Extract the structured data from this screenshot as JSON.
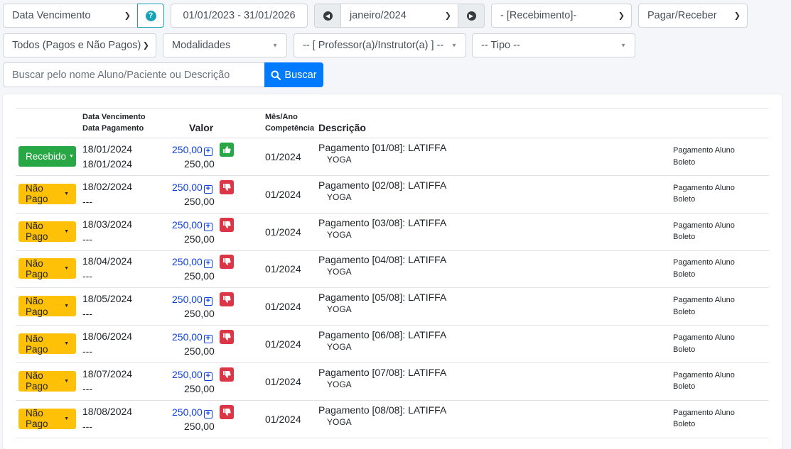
{
  "filters": {
    "date_type": "Data Vencimento",
    "date_range": "01/01/2023 - 31/01/2026",
    "month": "janeiro/2024",
    "recebimento": "- [Recebimento]-",
    "pagar_receber": "Pagar/Receber",
    "payment_status": "Todos (Pagos e Não Pagos)",
    "modalidades": "Modalidades",
    "professor": "-- [ Professor(a)/Instrutor(a) ] --",
    "tipo": "-- Tipo --"
  },
  "search": {
    "placeholder": "Buscar pelo nome Aluno/Paciente ou Descrição",
    "button_label": "Buscar"
  },
  "table": {
    "headers": {
      "due_date": "Data Vencimento",
      "pay_date": "Data Pagamento",
      "value": "Valor",
      "month_year": "Mês/Ano",
      "competence": "Competência",
      "description": "Descrição"
    },
    "rows": [
      {
        "status": "Recebido",
        "status_color": "#28a745",
        "due": "18/01/2024",
        "paid": "18/01/2024",
        "value": "250,00",
        "value_paid": "250,00",
        "thumb": "up",
        "competence": "01/2024",
        "description": "Pagamento [01/08]: LATIFFA",
        "modality": "YOGA",
        "tag1": "Pagamento Aluno",
        "tag2": "Boleto"
      },
      {
        "status": "Não Pago",
        "status_color": "#ffc107",
        "due": "18/02/2024",
        "paid": "---",
        "value": "250,00",
        "value_paid": "250,00",
        "thumb": "down",
        "competence": "01/2024",
        "description": "Pagamento [02/08]: LATIFFA",
        "modality": "YOGA",
        "tag1": "Pagamento Aluno",
        "tag2": "Boleto"
      },
      {
        "status": "Não Pago",
        "status_color": "#ffc107",
        "due": "18/03/2024",
        "paid": "---",
        "value": "250,00",
        "value_paid": "250,00",
        "thumb": "down",
        "competence": "01/2024",
        "description": "Pagamento [03/08]: LATIFFA",
        "modality": "YOGA",
        "tag1": "Pagamento Aluno",
        "tag2": "Boleto"
      },
      {
        "status": "Não Pago",
        "status_color": "#ffc107",
        "due": "18/04/2024",
        "paid": "---",
        "value": "250,00",
        "value_paid": "250,00",
        "thumb": "down",
        "competence": "01/2024",
        "description": "Pagamento [04/08]: LATIFFA",
        "modality": "YOGA",
        "tag1": "Pagamento Aluno",
        "tag2": "Boleto"
      },
      {
        "status": "Não Pago",
        "status_color": "#ffc107",
        "due": "18/05/2024",
        "paid": "---",
        "value": "250,00",
        "value_paid": "250,00",
        "thumb": "down",
        "competence": "01/2024",
        "description": "Pagamento [05/08]: LATIFFA",
        "modality": "YOGA",
        "tag1": "Pagamento Aluno",
        "tag2": "Boleto"
      },
      {
        "status": "Não Pago",
        "status_color": "#ffc107",
        "due": "18/06/2024",
        "paid": "---",
        "value": "250,00",
        "value_paid": "250,00",
        "thumb": "down",
        "competence": "01/2024",
        "description": "Pagamento [06/08]: LATIFFA",
        "modality": "YOGA",
        "tag1": "Pagamento Aluno",
        "tag2": "Boleto"
      },
      {
        "status": "Não Pago",
        "status_color": "#ffc107",
        "due": "18/07/2024",
        "paid": "---",
        "value": "250,00",
        "value_paid": "250,00",
        "thumb": "down",
        "competence": "01/2024",
        "description": "Pagamento [07/08]: LATIFFA",
        "modality": "YOGA",
        "tag1": "Pagamento Aluno",
        "tag2": "Boleto"
      },
      {
        "status": "Não Pago",
        "status_color": "#ffc107",
        "due": "18/08/2024",
        "paid": "---",
        "value": "250,00",
        "value_paid": "250,00",
        "thumb": "down",
        "competence": "01/2024",
        "description": "Pagamento [08/08]: LATIFFA",
        "modality": "YOGA",
        "tag1": "Pagamento Aluno",
        "tag2": "Boleto"
      }
    ]
  }
}
